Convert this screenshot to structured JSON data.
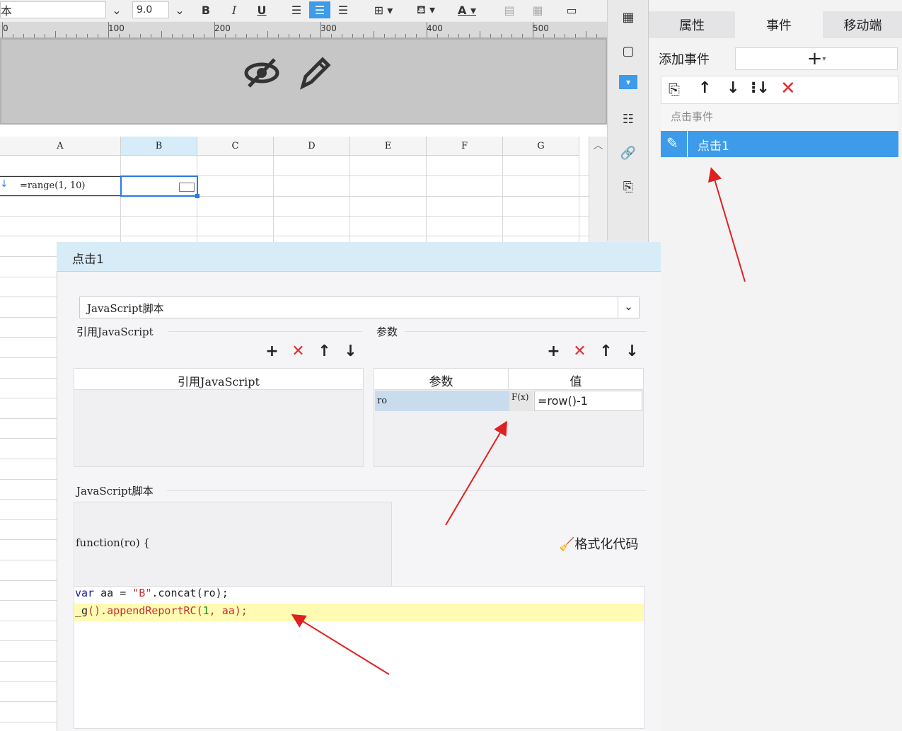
{
  "toolbar": {
    "font_fragment": "本",
    "font_size": "9.0",
    "bold": "B",
    "italic": "I",
    "underline": "U",
    "text_color_icon": "A"
  },
  "ruler": {
    "labels": [
      "0",
      "100",
      "200",
      "300",
      "400",
      "500"
    ]
  },
  "sheet": {
    "columns": [
      "A",
      "B",
      "C",
      "D",
      "E",
      "F",
      "G"
    ],
    "cell_a_formula": "=range(1, 10)"
  },
  "right_panel": {
    "tabs": [
      "属性",
      "事件",
      "移动端"
    ],
    "add_event_label": "添加事件",
    "add_symbol": "+",
    "section": "点击事件",
    "event_item": "点击1"
  },
  "dialog": {
    "title": "点击1",
    "type_select": "JavaScript脚本",
    "ref_js_section": "引用JavaScript",
    "params_section": "参数",
    "ref_js_column": "引用JavaScript",
    "params_columns": [
      "参数",
      "值"
    ],
    "param_name": "ro",
    "fx_label": "F(x)",
    "param_value": "=row()-1",
    "script_section": "JavaScript脚本",
    "function_sig": "function(ro) {",
    "format_code": "格式化代码",
    "code": {
      "l1_kw": "var",
      "l1_mid": " aa = ",
      "l1_str": "\"B\"",
      "l1_rest": ".concat(ro);",
      "l2_a": "_g",
      "l2_b": "().appendReportRC(",
      "l2_num": "1",
      "l2_c": ", aa);"
    }
  },
  "colors": {
    "accent": "#3d9be9",
    "selected_header": "#d6ecf8",
    "highlight_line": "#fffbb3",
    "arrow": "#e02020"
  }
}
